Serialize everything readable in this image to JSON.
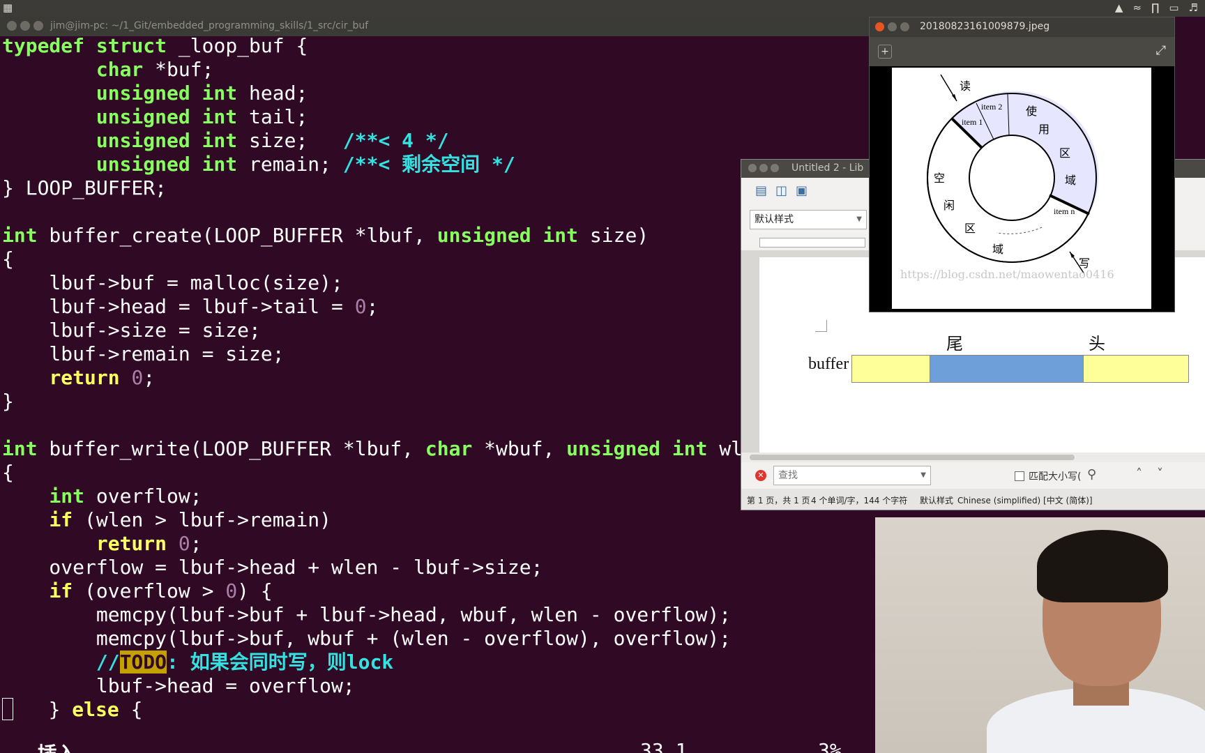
{
  "system_panel": {
    "tray_icons": [
      "penguin-icon",
      "wifi-icon",
      "bluetooth-icon",
      "battery-icon",
      "volume-icon"
    ]
  },
  "terminal": {
    "title": "jim@jim-pc: ~/1_Git/embedded_programming_skills/1_src/cir_buf",
    "status_mode": "-- 插入 --",
    "status_position": "33,1",
    "status_percent": "3%"
  },
  "lo_window": {
    "title": "Untitled 2 - Lib",
    "paragraph_style": "默认样式",
    "label_tail": "尾",
    "label_head": "头",
    "label_buffer": "buffer",
    "find_placeholder": "查找",
    "match_case": "匹配大小写(",
    "status": {
      "page": "第 1 页，共 1 页",
      "words": "4 个单词/字，144 个字符",
      "style": "默认样式",
      "language": "Chinese (simplified) [中文 (简体)]"
    }
  },
  "image_viewer": {
    "title": "20180823161009879.jpeg",
    "diagram": {
      "read": "读",
      "write": "写",
      "item2": "item 2",
      "item1": "item 1",
      "itemn": "item n",
      "used": [
        "使",
        "用",
        "区",
        "域"
      ],
      "free": [
        "空",
        "闲",
        "区",
        "域"
      ],
      "watermark": "https://blog.csdn.net/maowentao0416"
    }
  }
}
